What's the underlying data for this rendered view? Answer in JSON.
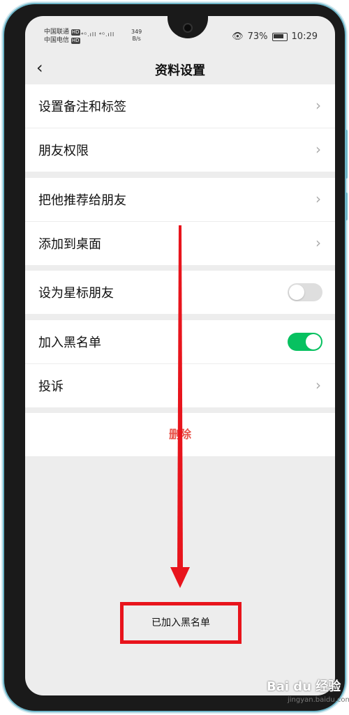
{
  "status_bar": {
    "carrier1": "中国联通",
    "carrier2": "中国电信",
    "hd": "HD",
    "signal": "⁴ᴳ.ıll ⁴ᴳ.ıll",
    "speed_value": "349",
    "speed_unit": "B/s",
    "battery_percent": "73%",
    "time": "10:29"
  },
  "header": {
    "back_icon": "chevron-left-icon",
    "title": "资料设置"
  },
  "groups": [
    {
      "items": [
        {
          "label": "设置备注和标签",
          "control": "chevron"
        },
        {
          "label": "朋友权限",
          "control": "chevron"
        }
      ]
    },
    {
      "items": [
        {
          "label": "把他推荐给朋友",
          "control": "chevron"
        },
        {
          "label": "添加到桌面",
          "control": "chevron"
        }
      ]
    },
    {
      "items": [
        {
          "label": "设为星标朋友",
          "control": "toggle",
          "on": false
        }
      ]
    },
    {
      "items": [
        {
          "label": "加入黑名单",
          "control": "toggle",
          "on": true
        },
        {
          "label": "投诉",
          "control": "chevron"
        }
      ]
    }
  ],
  "delete_label": "删除",
  "toast_text": "已加入黑名单",
  "colors": {
    "toggle_on": "#07c160",
    "toggle_off": "#dedede",
    "delete_text": "#e8534a",
    "annotation_red": "#e8141c",
    "background": "#ededed"
  },
  "watermark": {
    "brand": "Bai du 经验",
    "site": "jingyan.baidu.com"
  }
}
